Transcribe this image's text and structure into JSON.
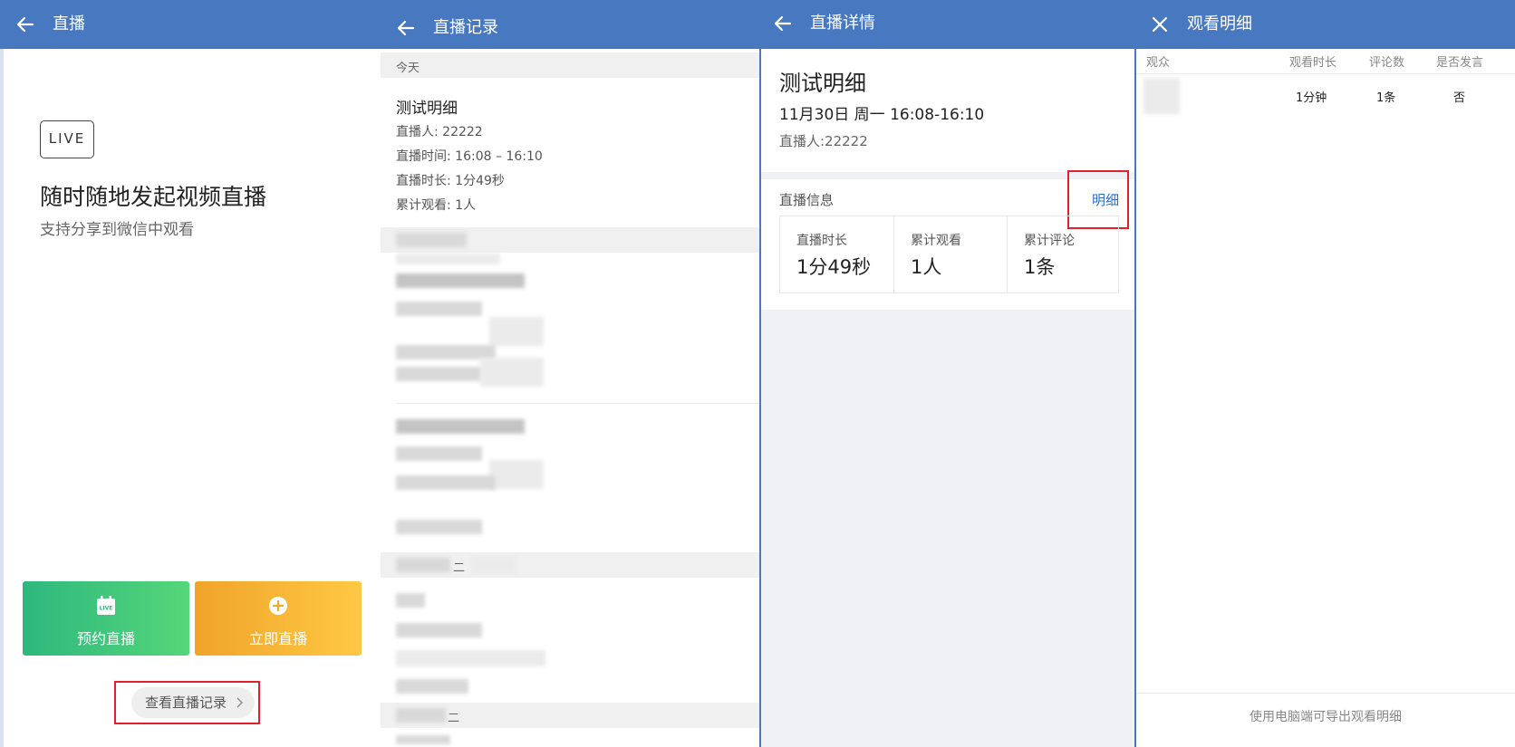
{
  "live_home": {
    "title": "直播",
    "badge": "LIVE",
    "headline": "随时随地发起视频直播",
    "subtitle": "支持分享到微信中观看",
    "schedule_button": "预约直播",
    "schedule_icon_text": "LIVE",
    "start_button": "立即直播",
    "records_button": "查看直播记录",
    "colors": {
      "appbar": "#4878c0",
      "schedule_gradient": [
        "#2db87e",
        "#55d67a"
      ],
      "start_gradient": [
        "#f0a42a",
        "#ffc844"
      ],
      "highlight_box": "#e0202a"
    }
  },
  "records": {
    "title": "直播记录",
    "section_today": "今天",
    "items": [
      {
        "title": "测试明细",
        "host": "直播人: 22222",
        "time": "直播时间: 16:08 – 16:10",
        "duration": "直播时长: 1分49秒",
        "viewers": "累计观看: 1人"
      }
    ],
    "section_label_3": "二",
    "section_label_4": "二"
  },
  "detail": {
    "title": "直播详情",
    "name": "测试明细",
    "datetime": "11月30日 周一 16:08-16:10",
    "host": "直播人:22222",
    "info_label": "直播信息",
    "detail_link": "明细",
    "stats": [
      {
        "label": "直播时长",
        "value": "1分49秒"
      },
      {
        "label": "累计观看",
        "value": "1人"
      },
      {
        "label": "累计评论",
        "value": "1条"
      }
    ]
  },
  "viewers": {
    "title": "观看明细",
    "columns": [
      "观众",
      "观看时长",
      "评论数",
      "是否发言"
    ],
    "rows": [
      {
        "duration": "1分钟",
        "comments": "1条",
        "spoke": "否"
      }
    ],
    "footer": "使用电脑端可导出观看明细"
  }
}
